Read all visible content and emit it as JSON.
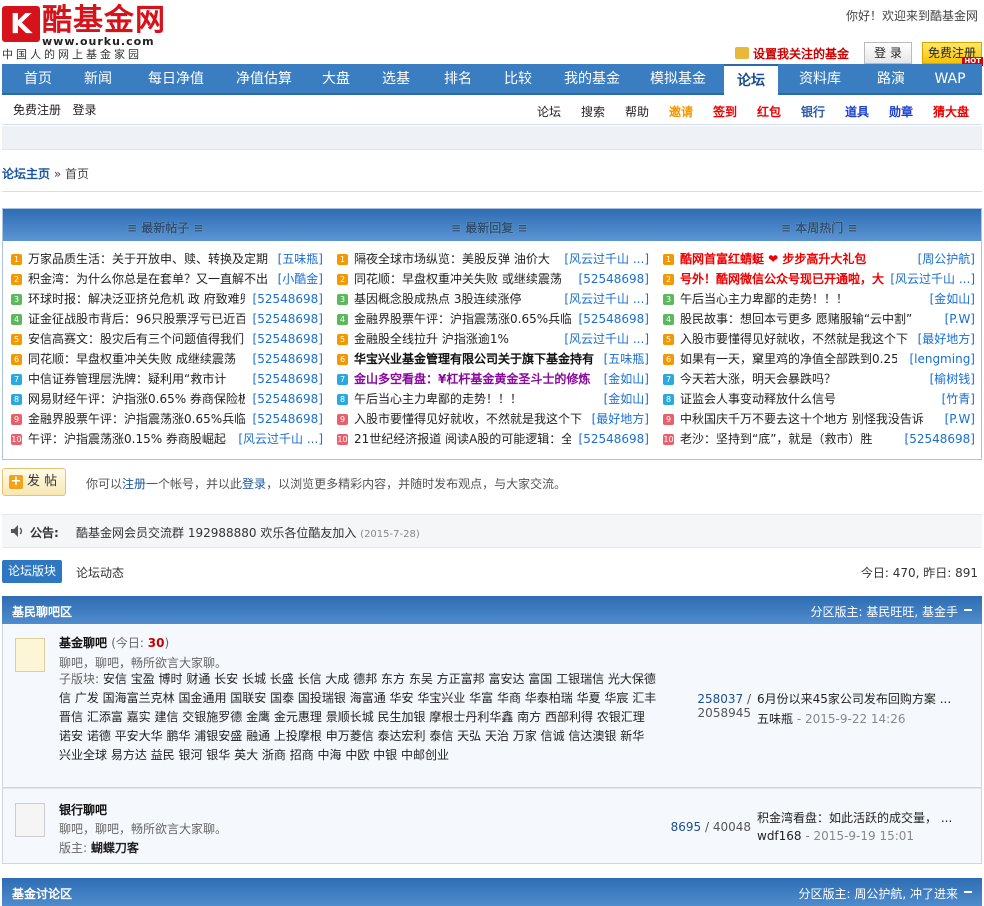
{
  "header": {
    "logo_text": "酷基金网",
    "logo_url": "www.ourku.com",
    "slogan": "中国人的网上基金家园",
    "welcome": "你好！欢迎来到酷基金网",
    "fav_label": "设置我关注的基金",
    "login": "登 录",
    "register": "免费注册",
    "hot_badge": "HOT"
  },
  "nav": [
    "首页",
    "新闻",
    "每日净值",
    "净值估算",
    "大盘",
    "选基",
    "排名",
    "比较",
    "我的基金",
    "模拟基金",
    "论坛",
    "资料库",
    "路演",
    "WAP"
  ],
  "subbar": {
    "left": [
      "免费注册",
      "登录"
    ],
    "right": [
      {
        "label": "论坛",
        "color": "#222"
      },
      {
        "label": "搜索",
        "color": "#222"
      },
      {
        "label": "帮助",
        "color": "#222"
      },
      {
        "label": "邀请",
        "color": "#f39800"
      },
      {
        "label": "签到",
        "color": "#e00"
      },
      {
        "label": "红包",
        "color": "#e00"
      },
      {
        "label": "银行",
        "color": "#2a5caa"
      },
      {
        "label": "道具",
        "color": "#1a3fd0"
      },
      {
        "label": "勋章",
        "color": "#1a3fd0"
      },
      {
        "label": "猜大盘",
        "color": "#e00"
      }
    ]
  },
  "breadcrumb": {
    "home": "论坛主页",
    "sep": "»",
    "current": "首页"
  },
  "hot": {
    "headers": [
      "最新帖子",
      "最新回复",
      "本周热门"
    ],
    "columns": [
      [
        {
          "t": "万家品质生活：关于开放申、赎、转换及定期",
          "u": "[五味瓶]"
        },
        {
          "t": "积金湾：为什么你总是在套单？又一直解不出",
          "u": "[小酷金]"
        },
        {
          "t": "环球时报：解决泛亚挤兑危机 政 府致难兜",
          "u": "[52548698]"
        },
        {
          "t": "证金征战股市背后：96只股票浮亏已近百",
          "u": "[52548698]"
        },
        {
          "t": "安信高赛文：股灾后有三个问题值得我们",
          "u": "[52548698]"
        },
        {
          "t": "同花顺：早盘权重冲关失败 成继续震荡",
          "u": "[52548698]"
        },
        {
          "t": "中信证券管理层洗牌：疑利用“救市计",
          "u": "[52548698]"
        },
        {
          "t": "网易财经午评：沪指涨0.65% 券商保险板",
          "u": "[52548698]"
        },
        {
          "t": "金融界股票午评：沪指震荡涨0.65%兵临",
          "u": "[52548698]"
        },
        {
          "t": "午评：沪指震荡涨0.15% 券商股崛起",
          "u": "[风云过千山 ...]"
        }
      ],
      [
        {
          "t": "隔夜全球市场纵览：美股反弹 油价大",
          "u": "[风云过千山 ...]"
        },
        {
          "t": "同花顺：早盘权重冲关失败 或继续震荡",
          "u": "[52548698]"
        },
        {
          "t": "基因概念股成热点 3股连续涨停",
          "u": "[风云过千山 ...]"
        },
        {
          "t": "金融界股票午评：沪指震荡涨0.65%兵临",
          "u": "[52548698]"
        },
        {
          "t": "金融股全线拉升 沪指涨逾1%",
          "u": "[风云过千山 ...]"
        },
        {
          "t": "华宝兴业基金管理有限公司关于旗下基金持有",
          "u": "[五味瓶]",
          "style": "bold"
        },
        {
          "t": "金山多空看盘：¥杠杆基金黄金圣斗士的修炼",
          "u": "[金如山]",
          "style": "purple"
        },
        {
          "t": "午后当心主力卑鄙的走势！！！",
          "u": "[金如山]"
        },
        {
          "t": "入股市要懂得见好就收，不然就是我这个下",
          "u": "[最好地方]"
        },
        {
          "t": "21世纪经济报道 阅读A股的可能逻辑：全",
          "u": "[52548698]"
        }
      ],
      [
        {
          "t": "酷网首富红蜻蜓 ❤ 步步高升大礼包",
          "u": "[周公护航]",
          "style": "red"
        },
        {
          "t": "号外！酷网微信公众号现已开通啦，大",
          "u": "[风云过千山 ...]",
          "style": "red"
        },
        {
          "t": "午后当心主力卑鄙的走势！！！",
          "u": "[金如山]"
        },
        {
          "t": "股民故事：想回本亏更多 愿赌服输“云中割”",
          "u": "[P.W]"
        },
        {
          "t": "入股市要懂得见好就收，不然就是我这个下",
          "u": "[最好地方]"
        },
        {
          "t": "如果有一天，窠里鸡的净值全部跌到0.25。",
          "u": "[lengming]"
        },
        {
          "t": "今天若大涨，明天会暴跌吗？",
          "u": "[榆树钱]"
        },
        {
          "t": "证监会人事变动释放什么信号",
          "u": "[竹青]"
        },
        {
          "t": "中秋国庆千万不要去这十个地方 别怪我没告诉",
          "u": "[P.W]"
        },
        {
          "t": "老沙：坚持到“底”，就是（救市）胜",
          "u": "[52548698]"
        }
      ]
    ],
    "num_colors": [
      "#f39800",
      "#f39800",
      "#5cb85c",
      "#5cb85c",
      "#f39800",
      "#f39800",
      "#2aa9e0",
      "#2aa9e0",
      "#e8606c",
      "#e8606c"
    ]
  },
  "post": {
    "button": "发 帖",
    "text_before": "你可以",
    "register_link": "注册",
    "text_mid": "一个帐号，并以此",
    "login_link": "登录",
    "text_after": "，以浏览更多精彩内容，并随时发布观点，与大家交流。"
  },
  "notice": {
    "label": "公告:",
    "message": "酷基金网会员交流群 192988880 欢乐各位酷友加入",
    "date": "(2015-7-28)"
  },
  "tabs": {
    "active": "论坛版块",
    "other": "论坛动态",
    "stats": "今日: 470, 昨日: 891"
  },
  "sections": [
    {
      "name": "基民聊吧区",
      "mods": "分区版主: 基民旺旺, 基金手",
      "forums": [
        {
          "name": "基金聊吧",
          "today_label": "(今日:",
          "today_count": "30",
          "today_close": ")",
          "desc": "聊吧，聊吧，畅所欲言大家聊。",
          "subs_label": "子版块:",
          "subs": "安信 宝盈 博时 财通 长安 长城 长盛 长信 大成 德邦 东方 东吴 方正富邦 富安达 富国 工银瑞信 光大保德信 广发 国海富兰克林 国金通用 国联安 国泰 国投瑞银 海富通 华安 华宝兴业 华富 华商 华泰柏瑞 华夏 华宸 汇丰晋信 汇添富 嘉实 建信 交银施罗德 金鹰 金元惠理 景顺长城 民生加银 摩根士丹利华鑫 南方 西部利得 农银汇理 诺安 诺德 平安大华 鹏华 浦银安盛 融通 上投摩根 申万菱信 泰达宏利 泰信 天弘 天治 万家 信诚 信达澳银 新华 兴业全球 易方达 益民 银河 银华 英大 浙商 招商 中海 中欧 中银 中邮创业",
          "topics": "258037",
          "posts": "2058945",
          "last_title": "6月份以来45家公司发布回购方案 ...",
          "last_user": "五味瓶",
          "last_date": "- 2015-9-22 14:26"
        },
        {
          "name": "银行聊吧",
          "desc": "聊吧，聊吧，畅所欲言大家聊。",
          "mod_label": "版主:",
          "mod": "蝴蝶刀客",
          "topics": "8695",
          "posts": "40048",
          "last_title": "积金湾看盘：如此活跃的成交量，  ...",
          "last_user": "wdf168",
          "last_date": "- 2015-9-19 15:01"
        }
      ]
    },
    {
      "name": "基金讨论区",
      "mods": "分区版主: 周公护航, 冲了进来"
    }
  ]
}
